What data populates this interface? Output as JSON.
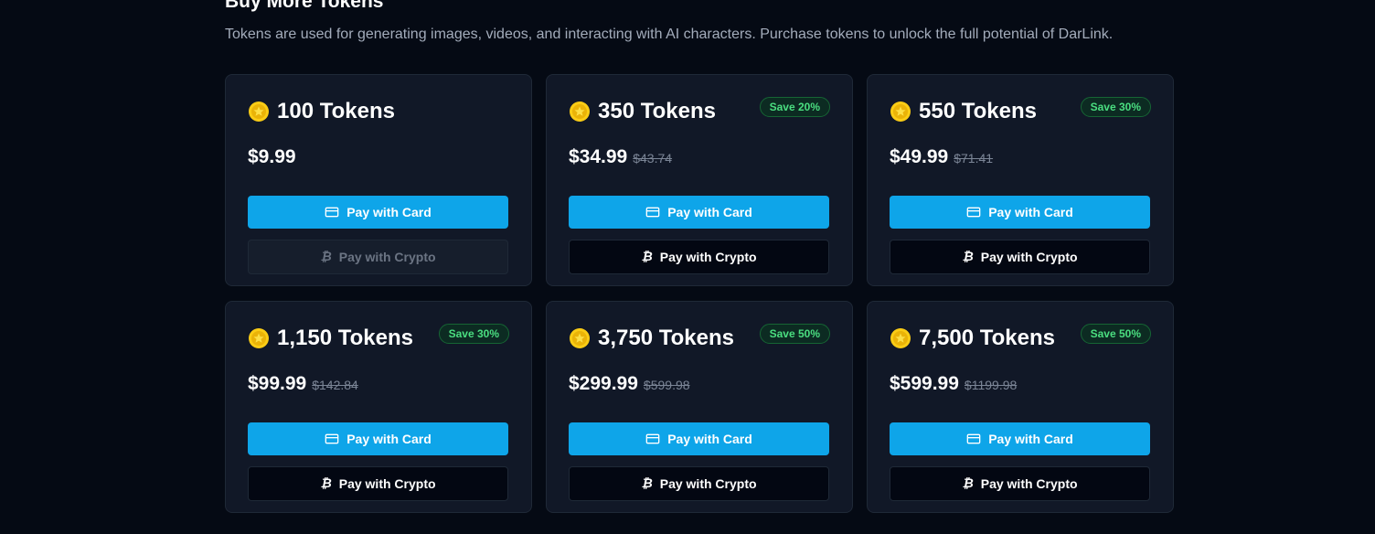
{
  "page": {
    "heading": "Buy More Tokens",
    "subtitle": "Tokens are used for generating images, videos, and interacting with AI characters. Purchase tokens to unlock the full potential of DarLink."
  },
  "colors": {
    "background": "#050a14",
    "card": "#111827",
    "accent": "#0ea5e9",
    "badge_text": "#4ade80",
    "coin": "#facc15"
  },
  "packages": [
    {
      "title": "100 Tokens",
      "price": "$9.99",
      "old_price": "",
      "badge": "",
      "card_label": "Pay with Card",
      "crypto_label": "Pay with Crypto",
      "crypto_disabled": true,
      "card_icon": "credit-card-icon",
      "crypto_icon": "bitcoin-icon"
    },
    {
      "title": "350 Tokens",
      "price": "$34.99",
      "old_price": "$43.74",
      "badge": "Save 20%",
      "card_label": "Pay with Card",
      "crypto_label": "Pay with Crypto",
      "crypto_disabled": false,
      "card_icon": "credit-card-icon",
      "crypto_icon": "bitcoin-icon"
    },
    {
      "title": "550 Tokens",
      "price": "$49.99",
      "old_price": "$71.41",
      "badge": "Save 30%",
      "card_label": "Pay with Card",
      "crypto_label": "Pay with Crypto",
      "crypto_disabled": false,
      "card_icon": "credit-card-icon",
      "crypto_icon": "bitcoin-icon"
    },
    {
      "title": "1,150 Tokens",
      "price": "$99.99",
      "old_price": "$142.84",
      "badge": "Save 30%",
      "card_label": "Pay with Card",
      "crypto_label": "Pay with Crypto",
      "crypto_disabled": false,
      "card_icon": "credit-card-icon",
      "crypto_icon": "bitcoin-icon"
    },
    {
      "title": "3,750 Tokens",
      "price": "$299.99",
      "old_price": "$599.98",
      "badge": "Save 50%",
      "card_label": "Pay with Card",
      "crypto_label": "Pay with Crypto",
      "crypto_disabled": false,
      "card_icon": "credit-card-icon",
      "crypto_icon": "bitcoin-icon"
    },
    {
      "title": "7,500 Tokens",
      "price": "$599.99",
      "old_price": "$1199.98",
      "badge": "Save 50%",
      "card_label": "Pay with Card",
      "crypto_label": "Pay with Crypto",
      "crypto_disabled": false,
      "card_icon": "credit-card-icon",
      "crypto_icon": "bitcoin-icon"
    }
  ]
}
